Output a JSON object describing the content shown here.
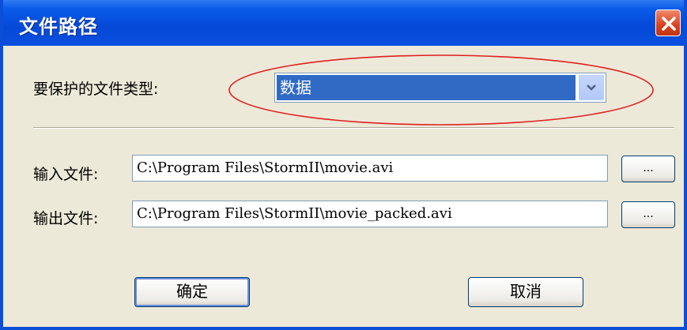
{
  "window": {
    "title": "文件路径"
  },
  "type_row": {
    "label": "要保护的文件类型:",
    "selected": "数据"
  },
  "input_row": {
    "label": "输入文件:",
    "value": "C:\\Program Files\\StormII\\movie.avi",
    "browse_label": "..."
  },
  "output_row": {
    "label": "输出文件:",
    "value": "C:\\Program Files\\StormII\\movie_packed.avi",
    "browse_label": "..."
  },
  "buttons": {
    "ok": "确定",
    "cancel": "取消"
  },
  "colors": {
    "titlebar": "#0548d8",
    "selection": "#316ac5",
    "highlight_ellipse": "#e02020",
    "face": "#ece9d8"
  }
}
